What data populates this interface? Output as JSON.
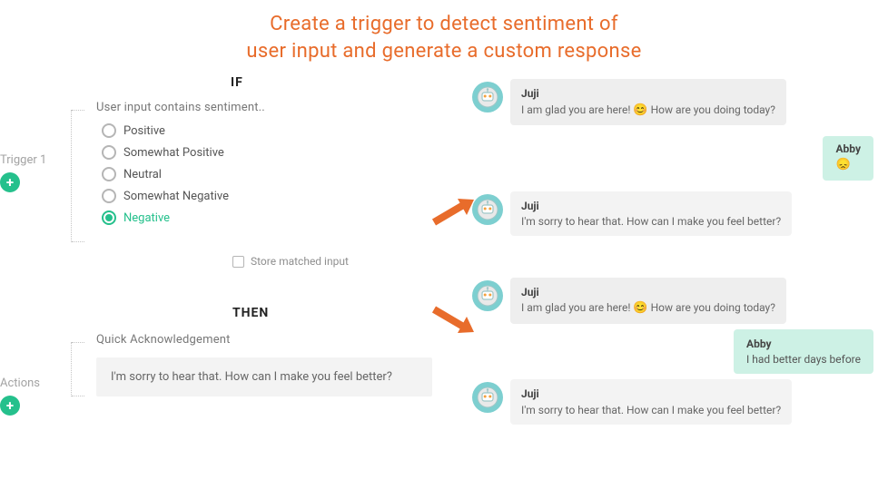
{
  "title_line1": "Create a trigger to detect sentiment of",
  "title_line2": "user input and generate a custom response",
  "if_label": "IF",
  "then_label": "THEN",
  "trigger": {
    "side_label": "Trigger 1",
    "header": "User input contains sentiment..",
    "options": {
      "positive": "Positive",
      "somewhat_positive": "Somewhat Positive",
      "neutral": "Neutral",
      "somewhat_negative": "Somewhat Negative",
      "negative": "Negative"
    }
  },
  "store_label": "Store matched input",
  "actions": {
    "side_label": "Actions",
    "header": "Quick Acknowledgement",
    "text": "I'm sorry to hear that. How can I make you feel better?"
  },
  "chat": {
    "bot_name": "Juji",
    "user_name": "Abby",
    "greet_prefix": "I am glad you are here! ",
    "greet_suffix": " How are you doing today?",
    "greet_emoji": "😊",
    "sorry": "I'm sorry to hear that. How can I make you feel better?",
    "sad_emoji": "😞",
    "user_reply_2": "I had better days before"
  }
}
